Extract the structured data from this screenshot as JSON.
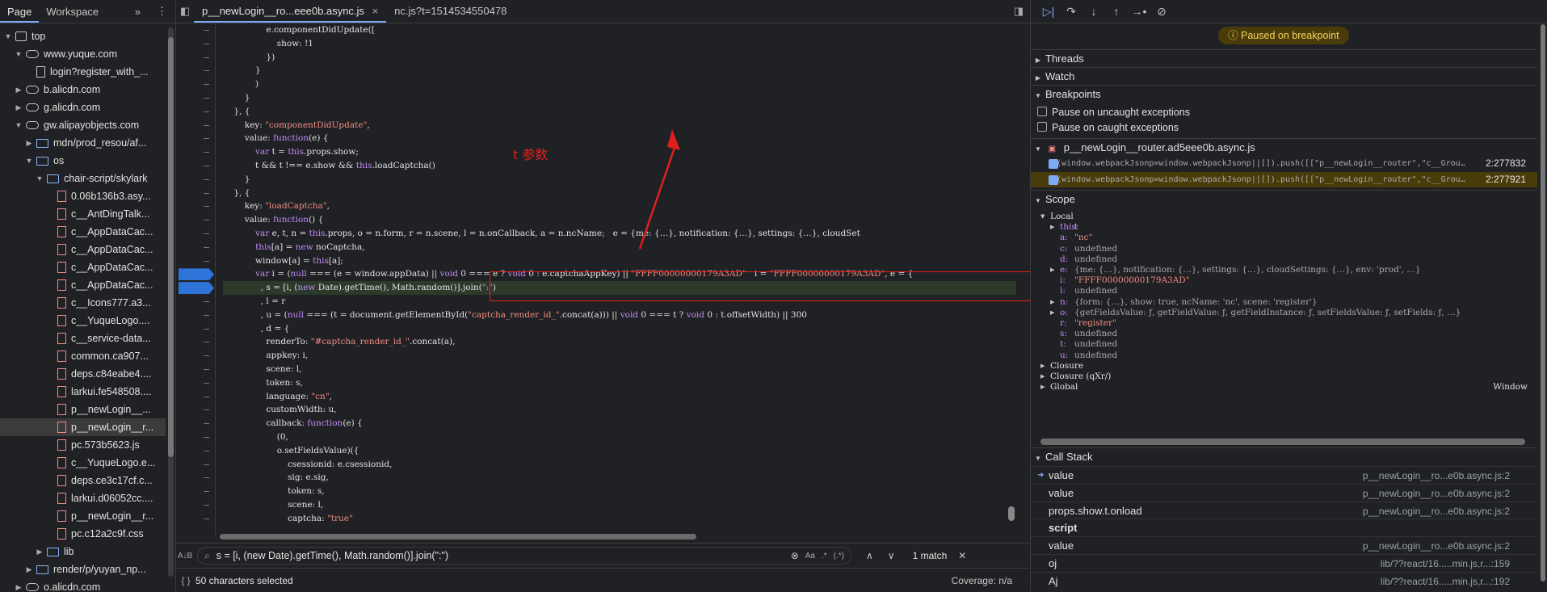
{
  "nav": {
    "tabs": [
      "Page",
      "Workspace"
    ],
    "more": "»",
    "tree": [
      {
        "indent": 0,
        "arrow": "▼",
        "icon": "frame",
        "label": "top"
      },
      {
        "indent": 1,
        "arrow": "▼",
        "icon": "cloud",
        "label": "www.yuque.com"
      },
      {
        "indent": 2,
        "arrow": "",
        "icon": "doc",
        "label": "login?register_with_..."
      },
      {
        "indent": 1,
        "arrow": "▶",
        "icon": "cloud",
        "label": "b.alicdn.com"
      },
      {
        "indent": 1,
        "arrow": "▶",
        "icon": "cloud",
        "label": "g.alicdn.com"
      },
      {
        "indent": 1,
        "arrow": "▼",
        "icon": "cloud",
        "label": "gw.alipayobjects.com"
      },
      {
        "indent": 2,
        "arrow": "▶",
        "icon": "folder",
        "label": "mdn/prod_resou/af..."
      },
      {
        "indent": 2,
        "arrow": "▼",
        "icon": "folder",
        "label": "os"
      },
      {
        "indent": 3,
        "arrow": "▼",
        "icon": "folder",
        "label": "chair-script/skylark"
      },
      {
        "indent": 4,
        "arrow": "",
        "icon": "file",
        "label": "0.06b136b3.asy..."
      },
      {
        "indent": 4,
        "arrow": "",
        "icon": "file",
        "label": "c__AntDingTalk..."
      },
      {
        "indent": 4,
        "arrow": "",
        "icon": "file",
        "label": "c__AppDataCac..."
      },
      {
        "indent": 4,
        "arrow": "",
        "icon": "file",
        "label": "c__AppDataCac..."
      },
      {
        "indent": 4,
        "arrow": "",
        "icon": "file",
        "label": "c__AppDataCac..."
      },
      {
        "indent": 4,
        "arrow": "",
        "icon": "file",
        "label": "c__AppDataCac..."
      },
      {
        "indent": 4,
        "arrow": "",
        "icon": "file",
        "label": "c__Icons777.a3..."
      },
      {
        "indent": 4,
        "arrow": "",
        "icon": "file",
        "label": "c__YuqueLogo...."
      },
      {
        "indent": 4,
        "arrow": "",
        "icon": "file",
        "label": "c__service-data..."
      },
      {
        "indent": 4,
        "arrow": "",
        "icon": "file",
        "label": "common.ca907..."
      },
      {
        "indent": 4,
        "arrow": "",
        "icon": "file",
        "label": "deps.c84eabe4...."
      },
      {
        "indent": 4,
        "arrow": "",
        "icon": "file",
        "label": "larkui.fe548508...."
      },
      {
        "indent": 4,
        "arrow": "",
        "icon": "file",
        "label": "p__newLogin__..."
      },
      {
        "indent": 4,
        "arrow": "",
        "icon": "file",
        "label": "p__newLogin__r...",
        "selected": true
      },
      {
        "indent": 4,
        "arrow": "",
        "icon": "file",
        "label": "pc.573b5623.js"
      },
      {
        "indent": 4,
        "arrow": "",
        "icon": "file",
        "label": "c__YuqueLogo.e..."
      },
      {
        "indent": 4,
        "arrow": "",
        "icon": "file",
        "label": "deps.ce3c17cf.c..."
      },
      {
        "indent": 4,
        "arrow": "",
        "icon": "file",
        "label": "larkui.d06052cc...."
      },
      {
        "indent": 4,
        "arrow": "",
        "icon": "file",
        "label": "p__newLogin__r..."
      },
      {
        "indent": 4,
        "arrow": "",
        "icon": "file",
        "label": "pc.c12a2c9f.css"
      },
      {
        "indent": 3,
        "arrow": "▶",
        "icon": "folder",
        "label": "lib"
      },
      {
        "indent": 2,
        "arrow": "▶",
        "icon": "folder",
        "label": "render/p/yuyan_np..."
      },
      {
        "indent": 1,
        "arrow": "▶",
        "icon": "cloud",
        "label": "o.alicdn.com"
      }
    ]
  },
  "editor": {
    "tabs": [
      {
        "label": "p__newLogin__ro...eee0b.async.js",
        "active": true,
        "close": "×"
      },
      {
        "label": "nc.js?t=1514534550478",
        "active": false
      }
    ],
    "annotation": "t 参数",
    "search": {
      "value": "s = [i, (new Date).getTime(), Math.random()].join(\":\")",
      "match_case": "Aa",
      "regex": ".*",
      "whole": "(.*)",
      "match_text": "1 match"
    },
    "status": {
      "selection": "50 characters selected",
      "coverage": "Coverage: n/a"
    },
    "code": [
      "                e.componentDidUpdate([",
      "                    show: !1",
      "                })",
      "            }",
      "            )",
      "        }",
      "    }, {",
      "        key: \"componentDidUpdate\",",
      "        value: function(e) {",
      "            var t = this.props.show;",
      "            t && t !== e.show && this.loadCaptcha()",
      "        }",
      "    }, {",
      "        key: \"loadCaptcha\",",
      "        value: function() {",
      "            var e, t, n = this.props, o = n.form, r = n.scene, l = n.onCallback, a = n.ncName;   e = {me: {…}, notification: {…}, settings: {…}, cloudSet",
      "            this[a] = new noCaptcha,",
      "            window[a] = this[a];",
      "            var i = (null === (e = window.appData) || void 0 === e ? void 0 : e.captchaAppKey) || \"FFFF00000000179A3AD\"   i = \"FFFF00000000179A3AD\", e = {",
      "              , s = [i, (new Date).getTime(), Math.random()].join(\":\")",
      "              , l = r",
      "              , u = (null === (t = document.getElementById(\"captcha_render_id_\".concat(a))) || void 0 === t ? void 0 : t.offsetWidth) || 300",
      "              , d = {",
      "                renderTo: \"#captcha_render_id_\".concat(a),",
      "                appkey: i,",
      "                scene: l,",
      "                token: s,",
      "                language: \"cn\",",
      "                customWidth: u,",
      "                callback: function(e) {",
      "                    (0,",
      "                    o.setFieldsValue)({",
      "                        csessionid: e.csessionid,",
      "                        sig: e.sig,",
      "                        token: s,",
      "                        scene: l,",
      "                        captcha: \"true\""
    ]
  },
  "debugger": {
    "toolbar": [
      "▷|",
      "↷",
      "↓",
      "↑",
      "→•",
      "⊘"
    ],
    "paused": "Paused on breakpoint",
    "sections": {
      "threads": "Threads",
      "watch": "Watch",
      "breakpoints": "Breakpoints",
      "scope": "Scope",
      "callstack": "Call Stack"
    },
    "pause_uncaught": "Pause on uncaught exceptions",
    "pause_caught": "Pause on caught exceptions",
    "bp_file": "p__newLogin__router.ad5eee0b.async.js",
    "bp_rows": [
      {
        "code": "(window.webpackJsonp=window.webpackJsonp||[]).push([[\"p__newLogin__router\",\"c__Grou…",
        "loc": "2:277832"
      },
      {
        "code": "(window.webpackJsonp=window.webpackJsonp||[]).push([[\"p__newLogin__router\",\"c__Grou…",
        "loc": "2:277921"
      }
    ],
    "scope": [
      {
        "indent": 0,
        "arrow": "▼",
        "key": "Local",
        "val": ""
      },
      {
        "indent": 1,
        "arrow": "▶",
        "key": "this:",
        "val": "t"
      },
      {
        "indent": 1,
        "arrow": "",
        "key": "a:",
        "val": "\"nc\""
      },
      {
        "indent": 1,
        "arrow": "",
        "key": "c:",
        "val": "undefined"
      },
      {
        "indent": 1,
        "arrow": "",
        "key": "d:",
        "val": "undefined"
      },
      {
        "indent": 1,
        "arrow": "▶",
        "key": "e:",
        "val": "{me: {…}, notification: {…}, settings: {…}, cloudSettings: {…}, env: 'prod', …}"
      },
      {
        "indent": 1,
        "arrow": "",
        "key": "i:",
        "val": "\"FFFF00000000179A3AD\""
      },
      {
        "indent": 1,
        "arrow": "",
        "key": "l:",
        "val": "undefined"
      },
      {
        "indent": 1,
        "arrow": "▶",
        "key": "n:",
        "val": "{form: {…}, show: true, ncName: 'nc', scene: 'register'}"
      },
      {
        "indent": 1,
        "arrow": "▶",
        "key": "o:",
        "val": "{getFieldsValue: ƒ, getFieldValue: ƒ, getFieldInstance: ƒ, setFieldsValue: ƒ, setFields: ƒ, …}"
      },
      {
        "indent": 1,
        "arrow": "",
        "key": "r:",
        "val": "\"register\""
      },
      {
        "indent": 1,
        "arrow": "",
        "key": "s:",
        "val": "undefined"
      },
      {
        "indent": 1,
        "arrow": "",
        "key": "t:",
        "val": "undefined"
      },
      {
        "indent": 1,
        "arrow": "",
        "key": "u:",
        "val": "undefined"
      },
      {
        "indent": 0,
        "arrow": "▶",
        "key": "Closure",
        "val": ""
      },
      {
        "indent": 0,
        "arrow": "▶",
        "key": "Closure (qXr/)",
        "val": ""
      },
      {
        "indent": 0,
        "arrow": "▶",
        "key": "Global",
        "val": "",
        "right": "Window"
      }
    ],
    "callstack": [
      {
        "fn": "value",
        "loc": "p__newLogin__ro...e0b.async.js:2",
        "current": true
      },
      {
        "fn": "value",
        "loc": "p__newLogin__ro...e0b.async.js:2"
      },
      {
        "fn": "props.show.t.onload",
        "loc": "p__newLogin__ro...e0b.async.js:2"
      },
      {
        "fn": "script",
        "loc": "",
        "group": true
      },
      {
        "fn": "value",
        "loc": "p__newLogin__ro...e0b.async.js:2"
      },
      {
        "fn": "oj",
        "loc": "lib/??react/16.....min.js,r...:159"
      },
      {
        "fn": "Aj",
        "loc": "lib/??react/16.....min.js,r...:192"
      }
    ]
  }
}
